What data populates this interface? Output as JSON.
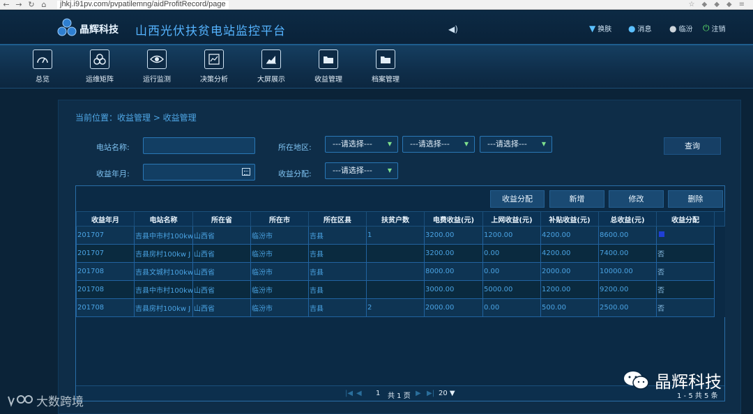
{
  "browser": {
    "url": "jhkj.i91pv.com/pvpatilemng/aidProfitRecord/page"
  },
  "header": {
    "brand": "晶辉科技",
    "title": "山西光伏扶贫电站监控平台",
    "links": {
      "skin": "换肤",
      "message": "消息",
      "user": "临汾",
      "logout": "注销"
    }
  },
  "nav": [
    {
      "label": "总览",
      "icon": "gauge-icon"
    },
    {
      "label": "运维矩阵",
      "icon": "matrix-icon"
    },
    {
      "label": "运行监测",
      "icon": "eye-icon"
    },
    {
      "label": "决策分析",
      "icon": "analysis-icon"
    },
    {
      "label": "大屏展示",
      "icon": "area-chart-icon"
    },
    {
      "label": "收益管理",
      "icon": "folder-icon"
    },
    {
      "label": "档案管理",
      "icon": "folder-icon"
    }
  ],
  "breadcrumb": "当前位置：收益管理 > 收益管理",
  "filters": {
    "station_name_label": "电站名称:",
    "region_label": "所在地区:",
    "month_label": "收益年月:",
    "distribution_label": "收益分配:",
    "select_placeholder": "---请选择---",
    "query_button": "查询"
  },
  "toolbar": {
    "distribute": "收益分配",
    "add": "新增",
    "edit": "修改",
    "delete": "删除"
  },
  "table": {
    "headers": [
      "收益年月",
      "电站名称",
      "所在省",
      "所在市",
      "所在区县",
      "扶贫户数",
      "电费收益(元)",
      "上网收益(元)",
      "补贴收益(元)",
      "总收益(元)",
      "收益分配"
    ],
    "rows": [
      [
        "201707",
        "吉县中市村100kw",
        "山西省",
        "临汾市",
        "吉县",
        "1",
        "3200.00",
        "1200.00",
        "4200.00",
        "8600.00",
        ""
      ],
      [
        "201707",
        "吉县房村100kw  J",
        "山西省",
        "临汾市",
        "吉县",
        "",
        "3200.00",
        "0.00",
        "4200.00",
        "7400.00",
        "否"
      ],
      [
        "201708",
        "吉县文城村100kw",
        "山西省",
        "临汾市",
        "吉县",
        "",
        "8000.00",
        "0.00",
        "2000.00",
        "10000.00",
        "否"
      ],
      [
        "201708",
        "吉县中市村100kw",
        "山西省",
        "临汾市",
        "吉县",
        "",
        "3000.00",
        "5000.00",
        "1200.00",
        "9200.00",
        "否"
      ],
      [
        "201708",
        "吉县房村100kw  J",
        "山西省",
        "临汾市",
        "吉县",
        "2",
        "2000.00",
        "0.00",
        "500.00",
        "2500.00",
        "否"
      ]
    ]
  },
  "pager": {
    "page": "1",
    "total_pages": "共 1 页",
    "page_size": "20 ▼",
    "summary": "1 - 5  共 5 条"
  },
  "watermarks": {
    "left": "大数跨境",
    "right": "晶辉科技"
  }
}
